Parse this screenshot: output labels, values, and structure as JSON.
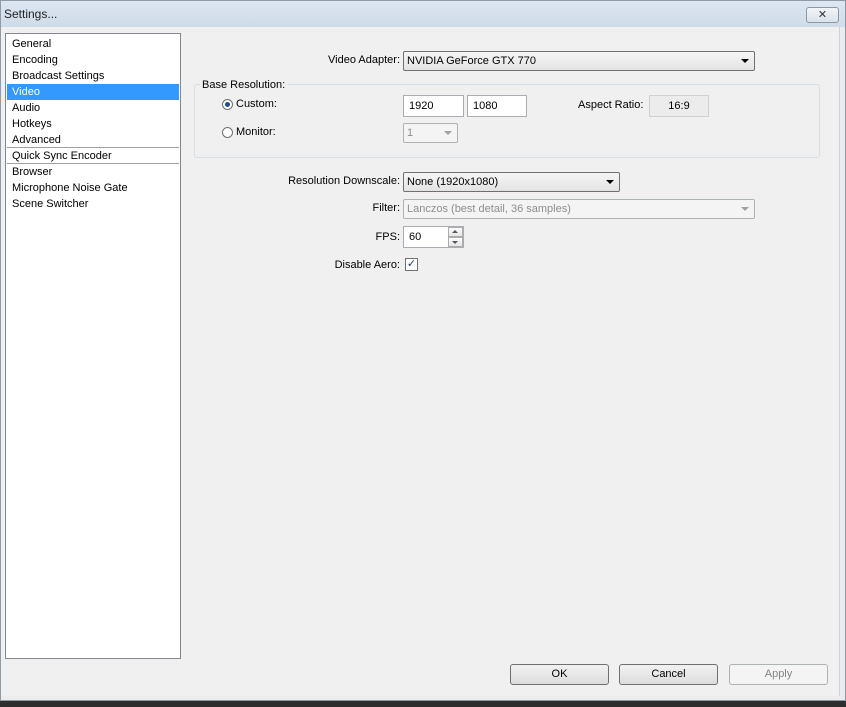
{
  "window": {
    "title": "Settings...",
    "close_glyph": "✕"
  },
  "sidebar": {
    "items": [
      {
        "label": "General"
      },
      {
        "label": "Encoding"
      },
      {
        "label": "Broadcast Settings"
      },
      {
        "label": "Video",
        "selected": true
      },
      {
        "label": "Audio"
      },
      {
        "label": "Hotkeys"
      },
      {
        "label": "Advanced"
      },
      {
        "label": "Quick Sync Encoder"
      },
      {
        "label": "Browser"
      },
      {
        "label": "Microphone Noise Gate"
      },
      {
        "label": "Scene Switcher"
      }
    ]
  },
  "video": {
    "adapter_label": "Video Adapter:",
    "adapter_value": "NVIDIA GeForce GTX 770",
    "base_resolution_label": "Base Resolution:",
    "custom_label": "Custom:",
    "custom_width": "1920",
    "custom_height": "1080",
    "aspect_ratio_label": "Aspect Ratio:",
    "aspect_ratio_value": "16:9",
    "monitor_label": "Monitor:",
    "monitor_value": "1",
    "downscale_label": "Resolution Downscale:",
    "downscale_value": "None  (1920x1080)",
    "filter_label": "Filter:",
    "filter_value": "Lanczos (best detail, 36 samples)",
    "fps_label": "FPS:",
    "fps_value": "60",
    "disable_aero_label": "Disable Aero:",
    "disable_aero_checked": true,
    "check_glyph": "✓"
  },
  "buttons": {
    "ok": "OK",
    "cancel": "Cancel",
    "apply": "Apply"
  },
  "colors": {
    "selection": "#3399ff",
    "dialog_bg": "#f0f0f0"
  }
}
